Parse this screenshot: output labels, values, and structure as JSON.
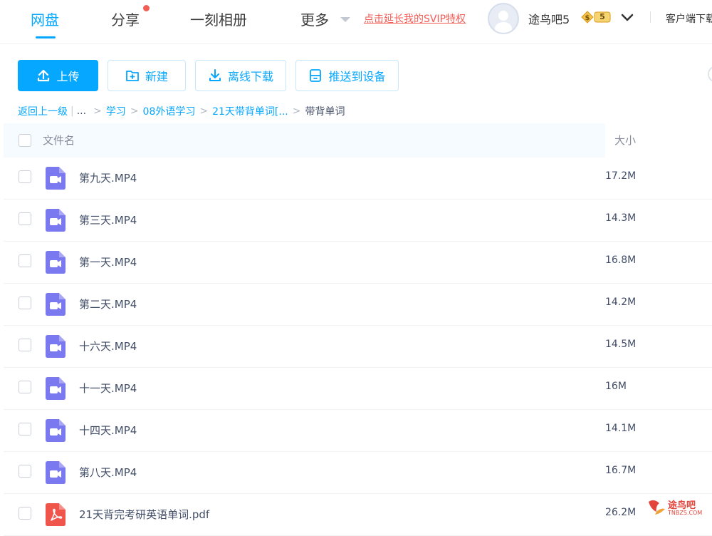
{
  "nav": {
    "items": [
      {
        "label": "网盘",
        "active": true
      },
      {
        "label": "分享",
        "active": false
      },
      {
        "label": "一刻相册",
        "active": false
      },
      {
        "label": "更多",
        "active": false
      }
    ],
    "svip_link": "点击延长我的SVIP特权",
    "username": "途鸟吧5",
    "vip_level": "5",
    "client_link": "客户端下载"
  },
  "toolbar": {
    "upload": "上传",
    "new": "新建",
    "offline_download": "离线下载",
    "push_to_device": "推送到设备"
  },
  "breadcrumb": {
    "back": "返回上一级",
    "ellipsis": "...",
    "path": [
      "学习",
      "08外语学习",
      "21天带背单词[..."
    ],
    "current": "带背单词"
  },
  "table": {
    "header_name": "文件名",
    "header_size": "大小",
    "rows": [
      {
        "name": "第九天.MP4",
        "size": "17.2M",
        "type": "video"
      },
      {
        "name": "第三天.MP4",
        "size": "14.3M",
        "type": "video"
      },
      {
        "name": "第一天.MP4",
        "size": "16.8M",
        "type": "video"
      },
      {
        "name": "第二天.MP4",
        "size": "14.2M",
        "type": "video"
      },
      {
        "name": "十六天.MP4",
        "size": "14.5M",
        "type": "video"
      },
      {
        "name": "十一天.MP4",
        "size": "16M",
        "type": "video"
      },
      {
        "name": "十四天.MP4",
        "size": "14.1M",
        "type": "video"
      },
      {
        "name": "第八天.MP4",
        "size": "16.7M",
        "type": "video"
      },
      {
        "name": "21天背完考研英语单词.pdf",
        "size": "26.2M",
        "type": "pdf"
      }
    ]
  },
  "watermark": {
    "text": "途鸟吧",
    "sub": "TNBZS.COM"
  },
  "colors": {
    "accent": "#06a7ff",
    "video_icon": "#7b79f0",
    "pdf_icon": "#f0554c",
    "svip_red": "#f25d56"
  },
  "icons": {
    "upload": "upload-icon",
    "new": "new-folder-icon",
    "offline": "download-icon",
    "push": "device-icon",
    "video": "video-file-icon",
    "pdf": "pdf-file-icon"
  }
}
